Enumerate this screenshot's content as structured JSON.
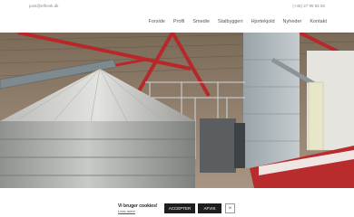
{
  "topbar": {
    "email": "post@elfresk.dk",
    "phone": "(+45) 27 95 55 50"
  },
  "nav": [
    "Forside",
    "Profil",
    "Smedie",
    "Stalbyggeri",
    "Hjortekjold",
    "Nyheder",
    "Kontakt"
  ],
  "cookie": {
    "title": "Vi bruger cookies!",
    "link": "Lees mere",
    "accept": "ACCEPTER",
    "reject": "AFVIS",
    "close": "×"
  }
}
